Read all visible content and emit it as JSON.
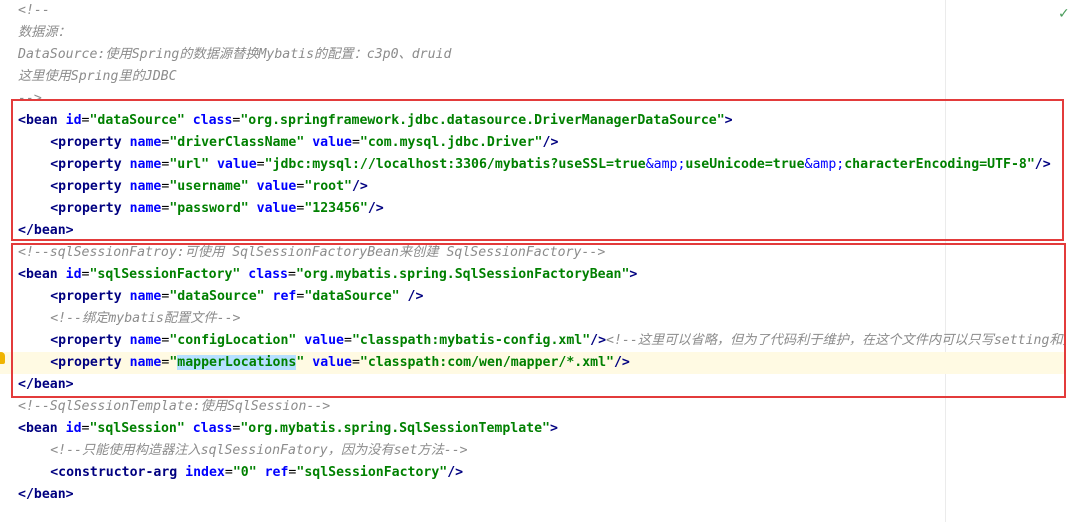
{
  "editor": {
    "status_check": "✓",
    "lines": [
      {
        "indent": 0,
        "hl": false,
        "tokens": [
          {
            "t": "comment",
            "v": "<!--"
          }
        ]
      },
      {
        "indent": 0,
        "hl": false,
        "tokens": [
          {
            "t": "comment",
            "v": "数据源："
          }
        ]
      },
      {
        "indent": 0,
        "hl": false,
        "tokens": [
          {
            "t": "comment",
            "v": "DataSource:使用Spring的数据源替换Mybatis的配置：c3p0、druid"
          }
        ]
      },
      {
        "indent": 0,
        "hl": false,
        "tokens": [
          {
            "t": "comment",
            "v": "这里使用Spring里的JDBC"
          }
        ]
      },
      {
        "indent": 0,
        "hl": false,
        "tokens": [
          {
            "t": "comment",
            "v": "-->"
          }
        ]
      },
      {
        "indent": 0,
        "hl": false,
        "tokens": [
          {
            "t": "tag",
            "v": "<bean "
          },
          {
            "t": "attr",
            "v": "id"
          },
          {
            "t": "plain",
            "v": "="
          },
          {
            "t": "val",
            "v": "\"dataSource\" "
          },
          {
            "t": "attr",
            "v": "class"
          },
          {
            "t": "plain",
            "v": "="
          },
          {
            "t": "val",
            "v": "\"org.springframework.jdbc.datasource.DriverManagerDataSource\""
          },
          {
            "t": "tag",
            "v": ">"
          }
        ]
      },
      {
        "indent": 4,
        "hl": false,
        "tokens": [
          {
            "t": "tag",
            "v": "<property "
          },
          {
            "t": "attr",
            "v": "name"
          },
          {
            "t": "plain",
            "v": "="
          },
          {
            "t": "val",
            "v": "\"driverClassName\" "
          },
          {
            "t": "attr",
            "v": "value"
          },
          {
            "t": "plain",
            "v": "="
          },
          {
            "t": "val",
            "v": "\"com.mysql.jdbc.Driver\""
          },
          {
            "t": "tag",
            "v": "/>"
          }
        ]
      },
      {
        "indent": 4,
        "hl": false,
        "tokens": [
          {
            "t": "tag",
            "v": "<property "
          },
          {
            "t": "attr",
            "v": "name"
          },
          {
            "t": "plain",
            "v": "="
          },
          {
            "t": "val",
            "v": "\"url\" "
          },
          {
            "t": "attr",
            "v": "value"
          },
          {
            "t": "plain",
            "v": "="
          },
          {
            "t": "val",
            "v": "\"jdbc:mysql://localhost:3306/mybatis?useSSL=true"
          },
          {
            "t": "ent",
            "v": "&amp;"
          },
          {
            "t": "val",
            "v": "useUnicode=true"
          },
          {
            "t": "ent",
            "v": "&amp;"
          },
          {
            "t": "val",
            "v": "characterEncoding=UTF-8\""
          },
          {
            "t": "tag",
            "v": "/>"
          }
        ]
      },
      {
        "indent": 4,
        "hl": false,
        "tokens": [
          {
            "t": "tag",
            "v": "<property "
          },
          {
            "t": "attr",
            "v": "name"
          },
          {
            "t": "plain",
            "v": "="
          },
          {
            "t": "val",
            "v": "\"username\" "
          },
          {
            "t": "attr",
            "v": "value"
          },
          {
            "t": "plain",
            "v": "="
          },
          {
            "t": "val",
            "v": "\"root\""
          },
          {
            "t": "tag",
            "v": "/>"
          }
        ]
      },
      {
        "indent": 4,
        "hl": false,
        "tokens": [
          {
            "t": "tag",
            "v": "<property "
          },
          {
            "t": "attr",
            "v": "name"
          },
          {
            "t": "plain",
            "v": "="
          },
          {
            "t": "val",
            "v": "\"password\" "
          },
          {
            "t": "attr",
            "v": "value"
          },
          {
            "t": "plain",
            "v": "="
          },
          {
            "t": "val",
            "v": "\"123456\""
          },
          {
            "t": "tag",
            "v": "/>"
          }
        ]
      },
      {
        "indent": 0,
        "hl": false,
        "tokens": [
          {
            "t": "tag",
            "v": "</bean>"
          }
        ]
      },
      {
        "indent": 0,
        "hl": false,
        "tokens": [
          {
            "t": "comment",
            "v": "<!--sqlSessionFatroy:可使用 SqlSessionFactoryBean来创建 SqlSessionFactory-->"
          }
        ]
      },
      {
        "indent": 0,
        "hl": false,
        "tokens": [
          {
            "t": "tag",
            "v": "<bean "
          },
          {
            "t": "attr",
            "v": "id"
          },
          {
            "t": "plain",
            "v": "="
          },
          {
            "t": "val",
            "v": "\"sqlSessionFactory\" "
          },
          {
            "t": "attr",
            "v": "class"
          },
          {
            "t": "plain",
            "v": "="
          },
          {
            "t": "val",
            "v": "\"org.mybatis.spring.SqlSessionFactoryBean\""
          },
          {
            "t": "tag",
            "v": ">"
          }
        ]
      },
      {
        "indent": 4,
        "hl": false,
        "tokens": [
          {
            "t": "tag",
            "v": "<property "
          },
          {
            "t": "attr",
            "v": "name"
          },
          {
            "t": "plain",
            "v": "="
          },
          {
            "t": "val",
            "v": "\"dataSource\" "
          },
          {
            "t": "attr",
            "v": "ref"
          },
          {
            "t": "plain",
            "v": "="
          },
          {
            "t": "val",
            "v": "\"dataSource\" "
          },
          {
            "t": "tag",
            "v": "/>"
          }
        ]
      },
      {
        "indent": 4,
        "hl": false,
        "tokens": [
          {
            "t": "comment",
            "v": "<!--绑定mybatis配置文件-->"
          }
        ]
      },
      {
        "indent": 4,
        "hl": false,
        "tokens": [
          {
            "t": "tag",
            "v": "<property "
          },
          {
            "t": "attr",
            "v": "name"
          },
          {
            "t": "plain",
            "v": "="
          },
          {
            "t": "val",
            "v": "\"configLocation\" "
          },
          {
            "t": "attr",
            "v": "value"
          },
          {
            "t": "plain",
            "v": "="
          },
          {
            "t": "val",
            "v": "\"classpath:mybatis-config.xml\""
          },
          {
            "t": "tag",
            "v": "/>"
          },
          {
            "t": "comment",
            "v": "<!--这里可以省略，但为了代码利于维护，在这个文件内可以只写setting和别名-->"
          }
        ]
      },
      {
        "indent": 4,
        "hl": true,
        "tokens": [
          {
            "t": "tag",
            "v": "<property "
          },
          {
            "t": "attr",
            "v": "name"
          },
          {
            "t": "plain",
            "v": "="
          },
          {
            "t": "val",
            "v": "\""
          },
          {
            "t": "valsel",
            "v": "mapperLocations"
          },
          {
            "t": "val",
            "v": "\" "
          },
          {
            "t": "attr",
            "v": "value"
          },
          {
            "t": "plain",
            "v": "="
          },
          {
            "t": "val",
            "v": "\"classpath:com/wen/mapper/*.xml\""
          },
          {
            "t": "tag",
            "v": "/>"
          }
        ]
      },
      {
        "indent": 0,
        "hl": false,
        "tokens": [
          {
            "t": "tag",
            "v": "</bean>"
          }
        ]
      },
      {
        "indent": 0,
        "hl": false,
        "tokens": [
          {
            "t": "comment",
            "v": "<!--SqlSessionTemplate:使用SqlSession-->"
          }
        ]
      },
      {
        "indent": 0,
        "hl": false,
        "tokens": [
          {
            "t": "tag",
            "v": "<bean "
          },
          {
            "t": "attr",
            "v": "id"
          },
          {
            "t": "plain",
            "v": "="
          },
          {
            "t": "val",
            "v": "\"sqlSession\" "
          },
          {
            "t": "attr",
            "v": "class"
          },
          {
            "t": "plain",
            "v": "="
          },
          {
            "t": "val",
            "v": "\"org.mybatis.spring.SqlSessionTemplate\""
          },
          {
            "t": "tag",
            "v": ">"
          }
        ]
      },
      {
        "indent": 4,
        "hl": false,
        "tokens": [
          {
            "t": "comment",
            "v": "<!--只能使用构造器注入sqlSessionFatory，因为没有set方法-->"
          }
        ]
      },
      {
        "indent": 4,
        "hl": false,
        "tokens": [
          {
            "t": "tag",
            "v": "<constructor-arg "
          },
          {
            "t": "attr",
            "v": "index"
          },
          {
            "t": "plain",
            "v": "="
          },
          {
            "t": "val",
            "v": "\"0\" "
          },
          {
            "t": "attr",
            "v": "ref"
          },
          {
            "t": "plain",
            "v": "="
          },
          {
            "t": "val",
            "v": "\"sqlSessionFactory\""
          },
          {
            "t": "tag",
            "v": "/>"
          }
        ]
      },
      {
        "indent": 0,
        "hl": false,
        "tokens": [
          {
            "t": "tag",
            "v": "</bean>"
          }
        ]
      }
    ]
  }
}
